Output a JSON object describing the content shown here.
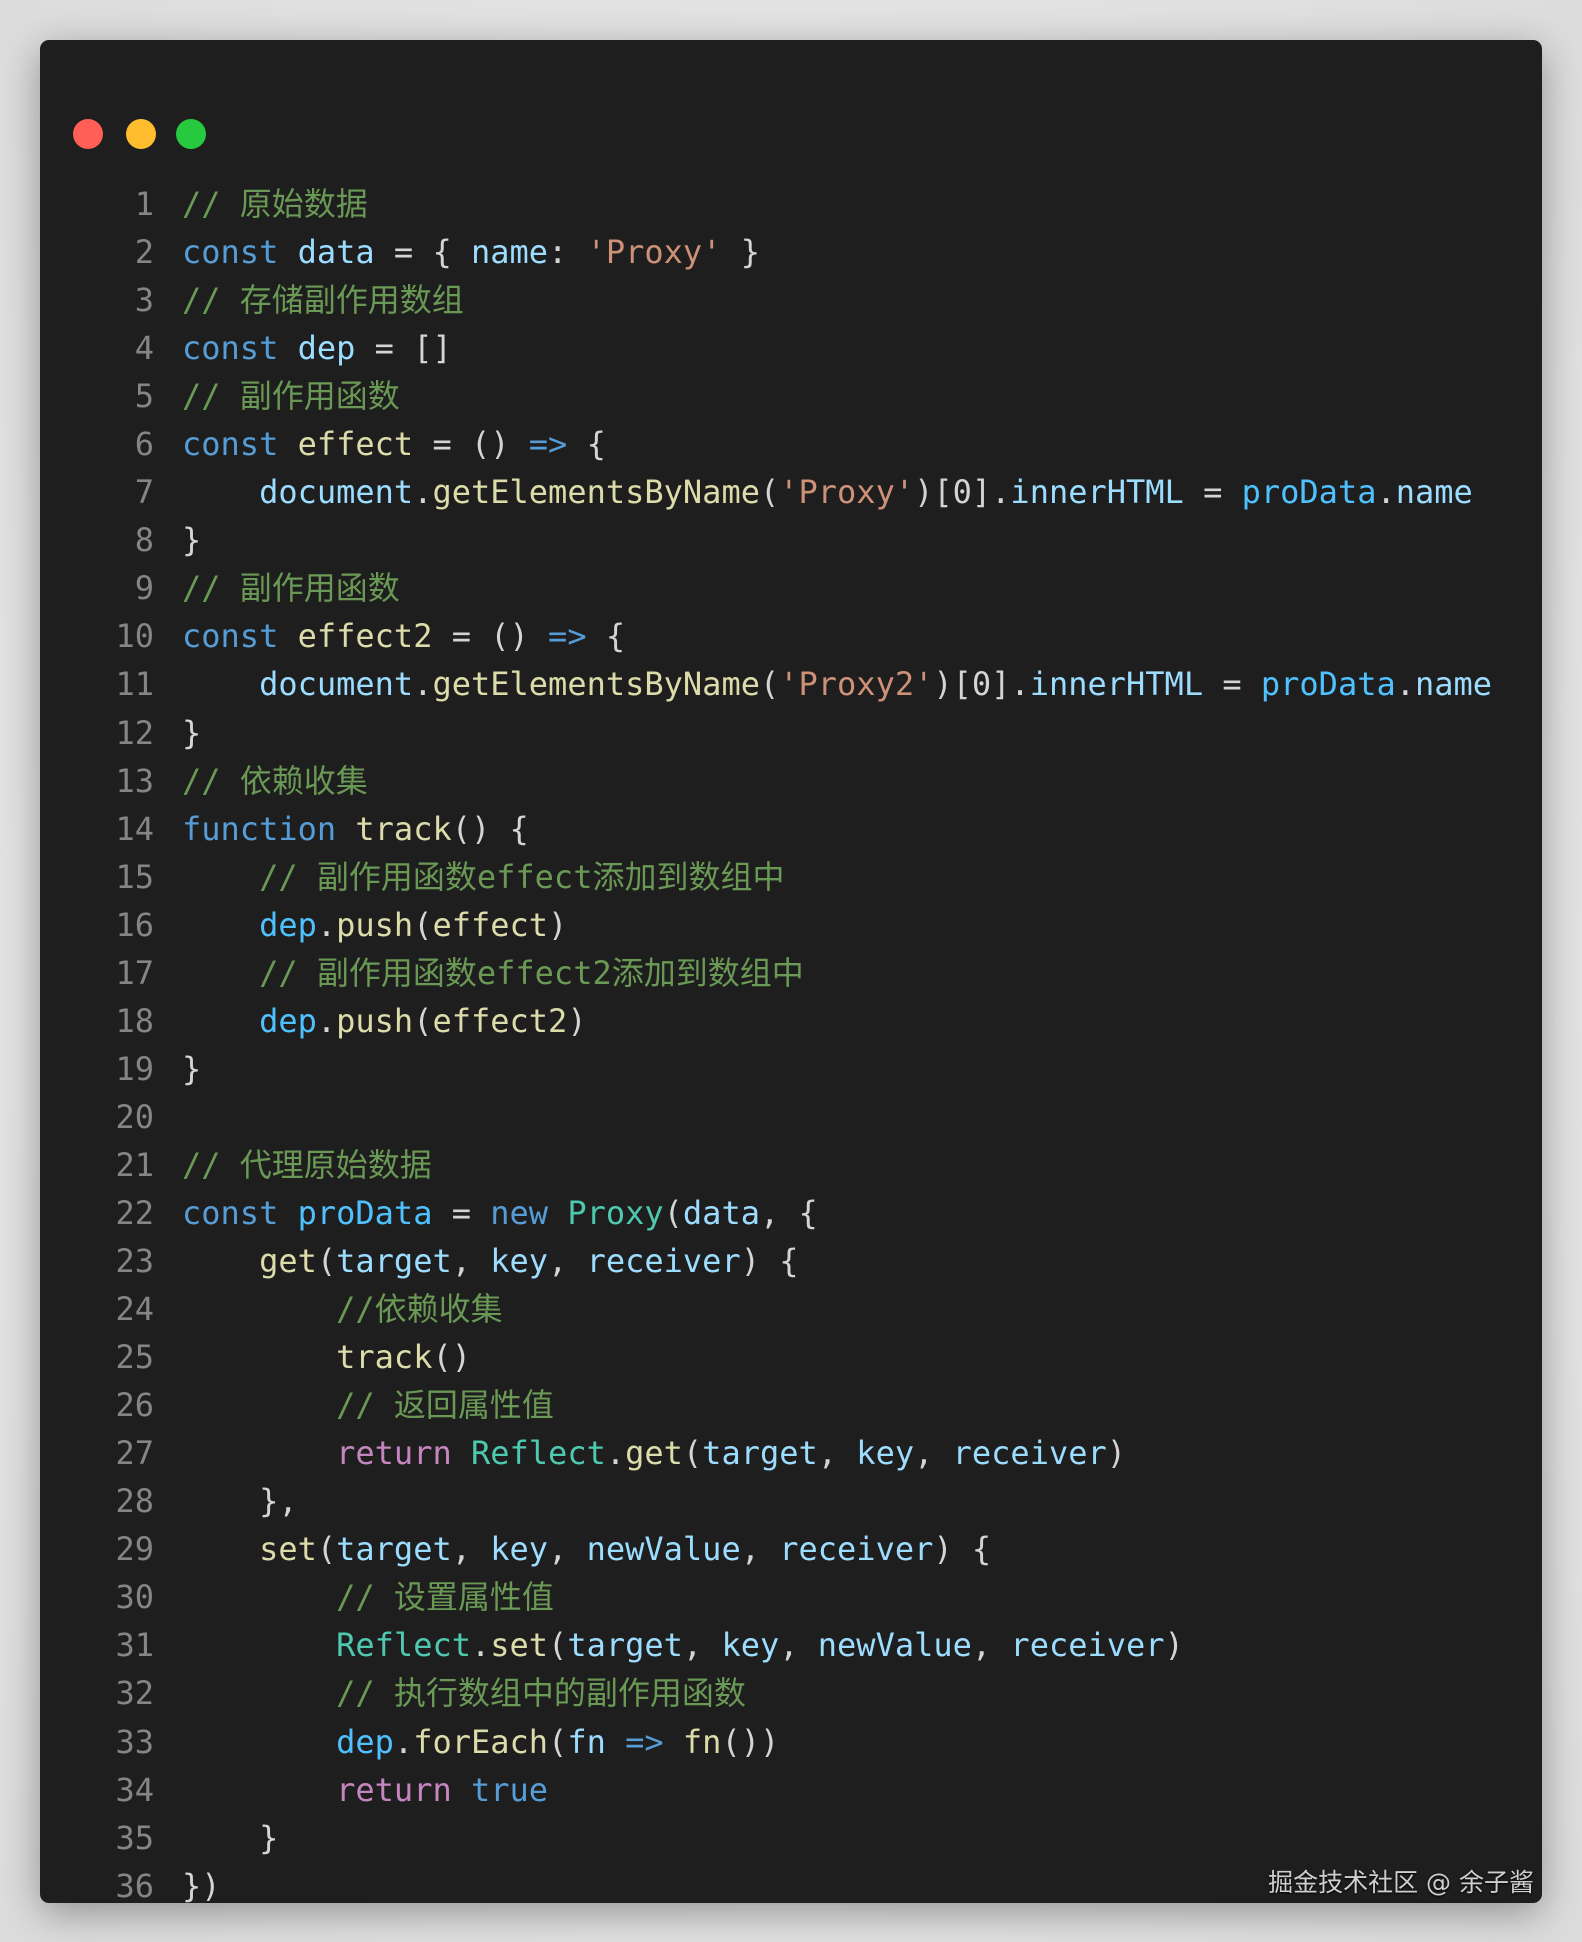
{
  "window": {
    "controls": [
      {
        "name": "close",
        "color": "#ff5f56"
      },
      {
        "name": "minimize",
        "color": "#ffbd2e"
      },
      {
        "name": "maximize",
        "color": "#27c93f"
      }
    ]
  },
  "watermark": "掘金技术社区 @ 余子酱",
  "code": [
    [
      [
        "c",
        "// 原始数据"
      ]
    ],
    [
      [
        "k",
        "const "
      ],
      [
        "v",
        "data"
      ],
      [
        "p",
        " = { "
      ],
      [
        "v",
        "name"
      ],
      [
        "p",
        ": "
      ],
      [
        "s",
        "'Proxy'"
      ],
      [
        "p",
        " }"
      ]
    ],
    [
      [
        "c",
        "// 存储副作用数组"
      ]
    ],
    [
      [
        "k",
        "const "
      ],
      [
        "v",
        "dep"
      ],
      [
        "p",
        " = []"
      ]
    ],
    [
      [
        "c",
        "// 副作用函数"
      ]
    ],
    [
      [
        "k",
        "const "
      ],
      [
        "f",
        "effect"
      ],
      [
        "p",
        " = () "
      ],
      [
        "k",
        "=>"
      ],
      [
        "p",
        " {"
      ]
    ],
    [
      [
        "p",
        "    "
      ],
      [
        "v",
        "document"
      ],
      [
        "p",
        "."
      ],
      [
        "f",
        "getElementsByName"
      ],
      [
        "p",
        "("
      ],
      [
        "s",
        "'Proxy'"
      ],
      [
        "p",
        ")[0]."
      ],
      [
        "v",
        "innerHTML"
      ],
      [
        "p",
        " = "
      ],
      [
        "b",
        "proData"
      ],
      [
        "p",
        "."
      ],
      [
        "v",
        "name"
      ]
    ],
    [
      [
        "p",
        "}"
      ]
    ],
    [
      [
        "c",
        "// 副作用函数"
      ]
    ],
    [
      [
        "k",
        "const "
      ],
      [
        "f",
        "effect2"
      ],
      [
        "p",
        " = () "
      ],
      [
        "k",
        "=>"
      ],
      [
        "p",
        " {"
      ]
    ],
    [
      [
        "p",
        "    "
      ],
      [
        "v",
        "document"
      ],
      [
        "p",
        "."
      ],
      [
        "f",
        "getElementsByName"
      ],
      [
        "p",
        "("
      ],
      [
        "s",
        "'Proxy2'"
      ],
      [
        "p",
        ")[0]."
      ],
      [
        "v",
        "innerHTML"
      ],
      [
        "p",
        " = "
      ],
      [
        "b",
        "proData"
      ],
      [
        "p",
        "."
      ],
      [
        "v",
        "name"
      ]
    ],
    [
      [
        "p",
        "}"
      ]
    ],
    [
      [
        "c",
        "// 依赖收集"
      ]
    ],
    [
      [
        "k",
        "function "
      ],
      [
        "f",
        "track"
      ],
      [
        "p",
        "() {"
      ]
    ],
    [
      [
        "p",
        "    "
      ],
      [
        "c",
        "// 副作用函数effect添加到数组中"
      ]
    ],
    [
      [
        "p",
        "    "
      ],
      [
        "b",
        "dep"
      ],
      [
        "p",
        "."
      ],
      [
        "f",
        "push"
      ],
      [
        "p",
        "("
      ],
      [
        "f",
        "effect"
      ],
      [
        "p",
        ")"
      ]
    ],
    [
      [
        "p",
        "    "
      ],
      [
        "c",
        "// 副作用函数effect2添加到数组中"
      ]
    ],
    [
      [
        "p",
        "    "
      ],
      [
        "b",
        "dep"
      ],
      [
        "p",
        "."
      ],
      [
        "f",
        "push"
      ],
      [
        "p",
        "("
      ],
      [
        "f",
        "effect2"
      ],
      [
        "p",
        ")"
      ]
    ],
    [
      [
        "p",
        "}"
      ]
    ],
    [],
    [
      [
        "c",
        "// 代理原始数据"
      ]
    ],
    [
      [
        "k",
        "const "
      ],
      [
        "b",
        "proData"
      ],
      [
        "p",
        " = "
      ],
      [
        "k",
        "new "
      ],
      [
        "t",
        "Proxy"
      ],
      [
        "p",
        "("
      ],
      [
        "v",
        "data"
      ],
      [
        "p",
        ", {"
      ]
    ],
    [
      [
        "p",
        "    "
      ],
      [
        "f",
        "get"
      ],
      [
        "p",
        "("
      ],
      [
        "v",
        "target"
      ],
      [
        "p",
        ", "
      ],
      [
        "v",
        "key"
      ],
      [
        "p",
        ", "
      ],
      [
        "v",
        "receiver"
      ],
      [
        "p",
        ") {"
      ]
    ],
    [
      [
        "p",
        "        "
      ],
      [
        "c",
        "//依赖收集"
      ]
    ],
    [
      [
        "p",
        "        "
      ],
      [
        "f",
        "track"
      ],
      [
        "p",
        "()"
      ]
    ],
    [
      [
        "p",
        "        "
      ],
      [
        "c",
        "// 返回属性值"
      ]
    ],
    [
      [
        "p",
        "        "
      ],
      [
        "r",
        "return "
      ],
      [
        "t",
        "Reflect"
      ],
      [
        "p",
        "."
      ],
      [
        "f",
        "get"
      ],
      [
        "p",
        "("
      ],
      [
        "v",
        "target"
      ],
      [
        "p",
        ", "
      ],
      [
        "v",
        "key"
      ],
      [
        "p",
        ", "
      ],
      [
        "v",
        "receiver"
      ],
      [
        "p",
        ")"
      ]
    ],
    [
      [
        "p",
        "    },"
      ]
    ],
    [
      [
        "p",
        "    "
      ],
      [
        "f",
        "set"
      ],
      [
        "p",
        "("
      ],
      [
        "v",
        "target"
      ],
      [
        "p",
        ", "
      ],
      [
        "v",
        "key"
      ],
      [
        "p",
        ", "
      ],
      [
        "v",
        "newValue"
      ],
      [
        "p",
        ", "
      ],
      [
        "v",
        "receiver"
      ],
      [
        "p",
        ") {"
      ]
    ],
    [
      [
        "p",
        "        "
      ],
      [
        "c",
        "// 设置属性值"
      ]
    ],
    [
      [
        "p",
        "        "
      ],
      [
        "t",
        "Reflect"
      ],
      [
        "p",
        "."
      ],
      [
        "f",
        "set"
      ],
      [
        "p",
        "("
      ],
      [
        "v",
        "target"
      ],
      [
        "p",
        ", "
      ],
      [
        "v",
        "key"
      ],
      [
        "p",
        ", "
      ],
      [
        "v",
        "newValue"
      ],
      [
        "p",
        ", "
      ],
      [
        "v",
        "receiver"
      ],
      [
        "p",
        ")"
      ]
    ],
    [
      [
        "p",
        "        "
      ],
      [
        "c",
        "// 执行数组中的副作用函数"
      ]
    ],
    [
      [
        "p",
        "        "
      ],
      [
        "b",
        "dep"
      ],
      [
        "p",
        "."
      ],
      [
        "f",
        "forEach"
      ],
      [
        "p",
        "("
      ],
      [
        "v",
        "fn"
      ],
      [
        "p",
        " "
      ],
      [
        "k",
        "=>"
      ],
      [
        "p",
        " "
      ],
      [
        "f",
        "fn"
      ],
      [
        "p",
        "())"
      ]
    ],
    [
      [
        "p",
        "        "
      ],
      [
        "r",
        "return "
      ],
      [
        "k",
        "true"
      ]
    ],
    [
      [
        "p",
        "    }"
      ]
    ],
    [
      [
        "p",
        "})"
      ]
    ]
  ]
}
